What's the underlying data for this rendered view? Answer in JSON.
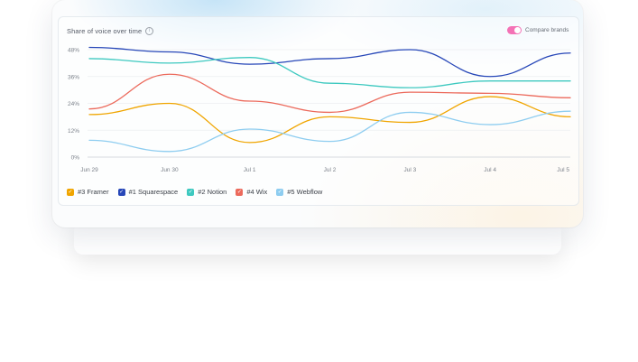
{
  "header": {
    "title": "Share of voice over time",
    "info_icon": "info-icon",
    "compare_label": "Compare brands",
    "compare_on": true
  },
  "chart_data": {
    "type": "line",
    "title": "Share of voice over time",
    "xlabel": "",
    "ylabel": "",
    "categories": [
      "Jun 29",
      "Jun 30",
      "Jul 1",
      "Jul 2",
      "Jul 3",
      "Jul 4",
      "Jul 5"
    ],
    "y_ticks": [
      "48%",
      "36%",
      "24%",
      "12%",
      "0%"
    ],
    "ylim": [
      0,
      48
    ],
    "grid": true,
    "legend_position": "bottom-left",
    "series": [
      {
        "name": "#3 Framer",
        "color": "#f0a500",
        "values": [
          19,
          24,
          6.5,
          18,
          15.5,
          27,
          18
        ]
      },
      {
        "name": "#1 Squarespace",
        "color": "#2747b8",
        "values": [
          49,
          47,
          41.5,
          44,
          48,
          36,
          46.5
        ]
      },
      {
        "name": "#2 Notion",
        "color": "#3ec9c0",
        "values": [
          44,
          42,
          44.5,
          33,
          31,
          34,
          34
        ]
      },
      {
        "name": "#4 Wix",
        "color": "#ec6a5c",
        "values": [
          21.5,
          37,
          25,
          20,
          29,
          28.5,
          26.5
        ]
      },
      {
        "name": "#5 Webflow",
        "color": "#8ecdf0",
        "values": [
          7.5,
          2.5,
          12.5,
          7,
          20,
          14.5,
          20.5
        ]
      }
    ]
  }
}
